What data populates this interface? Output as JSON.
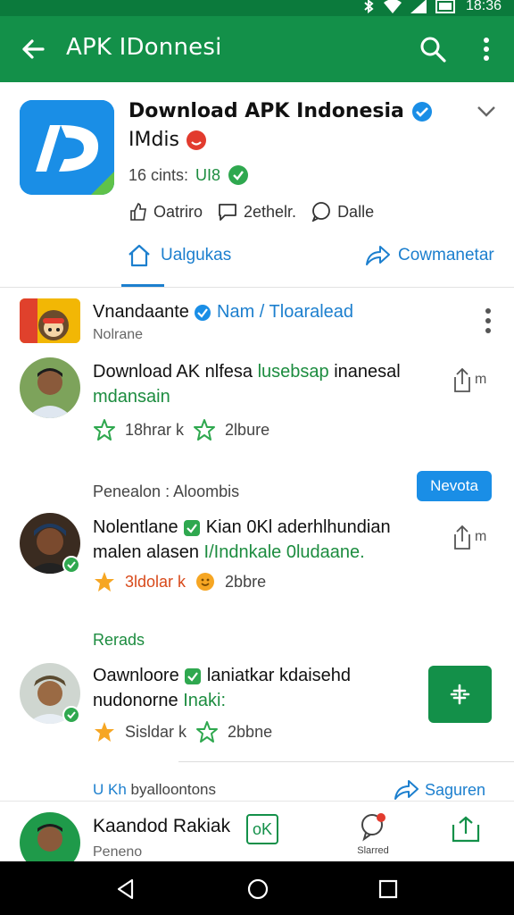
{
  "status_bar": {
    "time": "18:36"
  },
  "app_bar": {
    "title": "APK IDonnesi"
  },
  "header": {
    "title": "Download APK Indonesia",
    "subtitle": "IMdis",
    "meta_text": "16 cints:",
    "meta_highlight": "UI8",
    "actions": [
      {
        "label": "Oatriro",
        "icon": "like-icon"
      },
      {
        "label": "2ethelr.",
        "icon": "comment-icon"
      },
      {
        "label": "Dalle",
        "icon": "chat-icon"
      }
    ],
    "tab_update": "Ualgukas",
    "tab_comment": "Cowmanetar"
  },
  "section": {
    "title": "Vnandaante",
    "title_link": "Nam / Tloaralead",
    "subtitle": "Nolrane"
  },
  "posts": [
    {
      "text_main": "Download AK nlfesa",
      "text_green": "lusebsap",
      "text_rest": "inanesal",
      "text_line2": "mdansain",
      "stat_1": "18hrar k",
      "stat_2": "2lbure",
      "share_label": "m"
    },
    {
      "category": "Penealon : Aloombis",
      "follow_label": "Nevota",
      "text_main": "Nolentlane",
      "text_rest": "Kian 0Kl aderhlhundian",
      "text_line2_a": "malen alasen",
      "text_line2_b": "I/Indnkale 0ludaane.",
      "stat_1": "3ldolar k",
      "stat_2": "2bbre",
      "share_label": "m"
    },
    {
      "category": "Rerads",
      "text_main": "Oawnloore",
      "text_rest": "laniatkar kdaisehd",
      "text_line2_a": "nudonorne",
      "text_line2_b": "Inaki:",
      "stat_1": "Sisldar k",
      "stat_2": "2bbne"
    }
  ],
  "footer_row": {
    "left_b": "U Kh",
    "left": "byalloontons",
    "right": "Saguren"
  },
  "bottom_card": {
    "name": "Kaandod Rakiak",
    "sub": "Peneno",
    "ok_label": "oK",
    "bell_label": "Slarred"
  },
  "colors": {
    "primary_green": "#139049",
    "accent_blue": "#1a8ee6",
    "link_blue": "#1c7fce"
  }
}
